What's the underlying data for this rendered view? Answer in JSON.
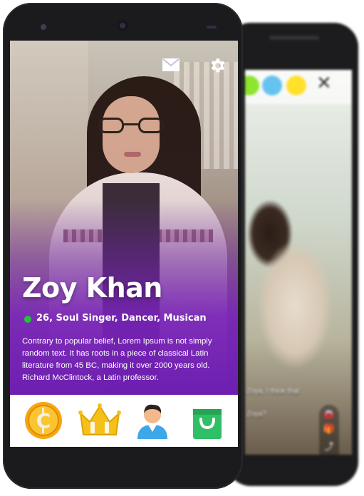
{
  "profile": {
    "name": "Zoy Khan",
    "tagline": "26, Soul Singer, Dancer, Musican",
    "bio": "Contrary to popular belief, Lorem Ipsum is not simply random text. It has roots in a piece of classical Latin literature from 45 BC, making it over 2000 years old. Richard McClintock, a Latin professor.",
    "online_status_color": "#22c335"
  },
  "top_icons": [
    "mail-icon",
    "gear-icon"
  ],
  "bottom_nav": [
    "coin-icon",
    "crown-icon",
    "avatar-icon",
    "shopping-bag-icon"
  ],
  "back_screen": {
    "color_dots": [
      "#8ee52f",
      "#66c3f0",
      "#ffe12c"
    ],
    "chat_lines": [
      "Zoya, I think that",
      "Zoya?"
    ],
    "side_actions": [
      "car-icon",
      "gift-icon",
      "share-icon",
      "chevron-down-icon"
    ]
  },
  "colors": {
    "overlay_purple": "#6d1fb0",
    "coin_gold": "#f6b21b",
    "crown_gold": "#f5c118",
    "bag_green": "#2fbf64"
  }
}
